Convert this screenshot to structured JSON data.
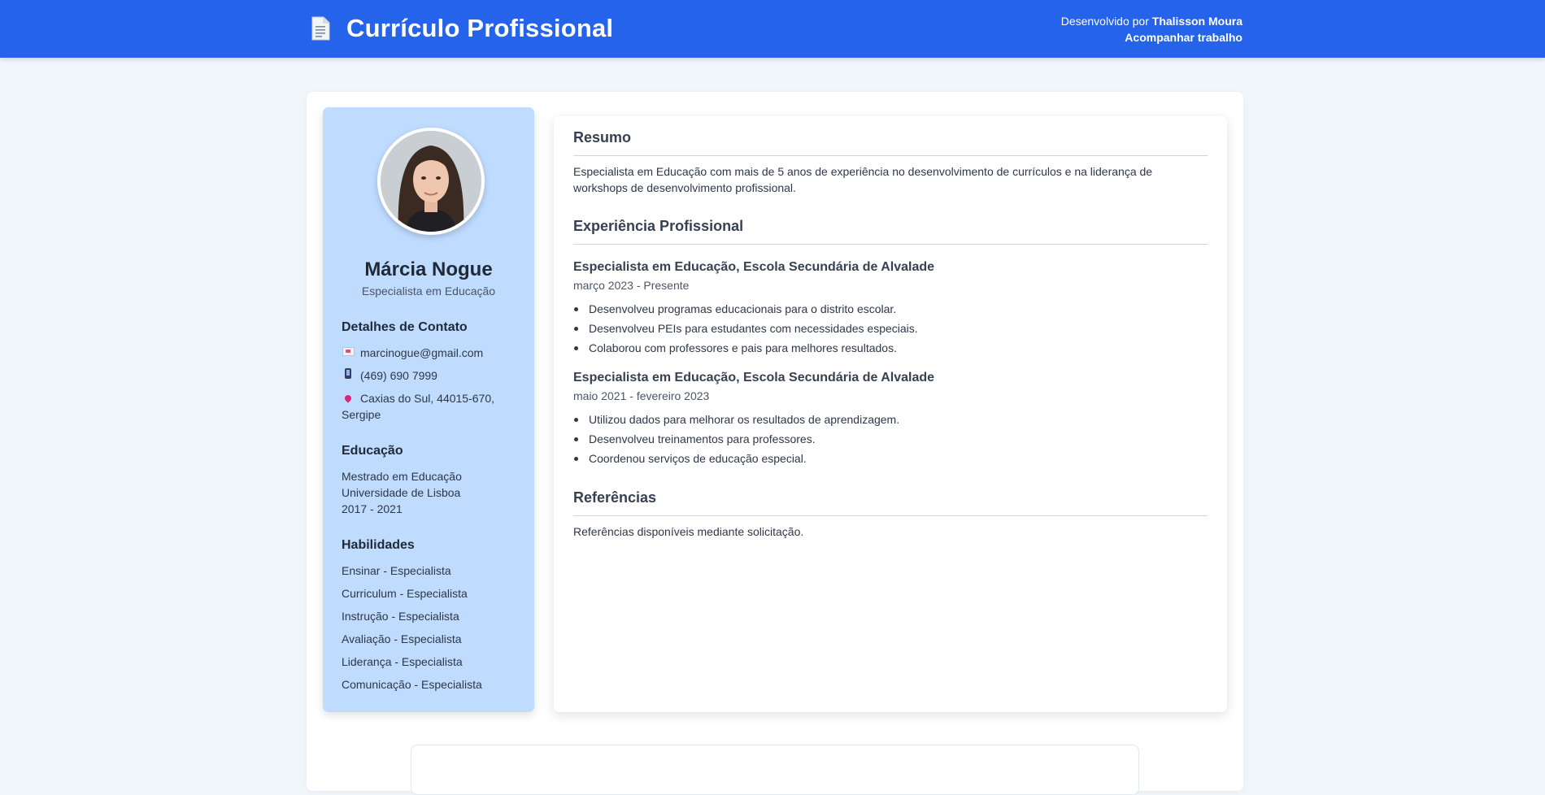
{
  "header": {
    "icon": "document-icon",
    "title": "Currículo Profissional",
    "credit_prefix": "Desenvolvido por",
    "credit_name": "Thalisson Moura",
    "follow_link": "Acompanhar trabalho",
    "color": "#2563eb"
  },
  "sidebar": {
    "name": "Márcia Nogue",
    "role": "Especialista em Educação",
    "contact_heading": "Detalhes de Contato",
    "email": "marcinogue@gmail.com",
    "phone": "(469) 690 7999",
    "address_line1": "Caxias do Sul, 44015-670,",
    "address_line2": "Sergipe",
    "education_heading": "Educação",
    "education": {
      "degree": "Mestrado em Educação",
      "school": "Universidade de Lisboa",
      "years": "2017 - 2021"
    },
    "skills_heading": "Habilidades",
    "skills": [
      "Ensinar - Especialista",
      "Curriculum - Especialista",
      "Instrução - Especialista",
      "Avaliação - Especialista",
      "Liderança - Especialista",
      "Comunicação - Especialista"
    ],
    "color": "#bfdbfe"
  },
  "main": {
    "summary_heading": "Resumo",
    "summary_line1": "Especialista em Educação com mais de 5 anos de experiência no desenvolvimento de currículos e na liderança de",
    "summary_line2": "workshops de desenvolvimento profissional.",
    "experience_heading": "Experiência Profissional",
    "jobs": [
      {
        "title": "Especialista em Educação, Escola Secundária de Alvalade",
        "dates": "março 2023 - Presente",
        "bullets": [
          "Desenvolveu programas educacionais para o distrito escolar.",
          "Desenvolveu PEIs para estudantes com necessidades especiais.",
          "Colaborou com professores e pais para melhores resultados."
        ]
      },
      {
        "title": "Especialista em Educação, Escola Secundária de Alvalade",
        "dates": "maio 2021 - fevereiro 2023",
        "bullets": [
          "Utilizou dados para melhorar os resultados de aprendizagem.",
          "Desenvolveu treinamentos para professores.",
          "Coordenou serviços de educação especial."
        ]
      }
    ],
    "references_heading": "Referências",
    "references_text": "Referências disponíveis mediante solicitação."
  }
}
